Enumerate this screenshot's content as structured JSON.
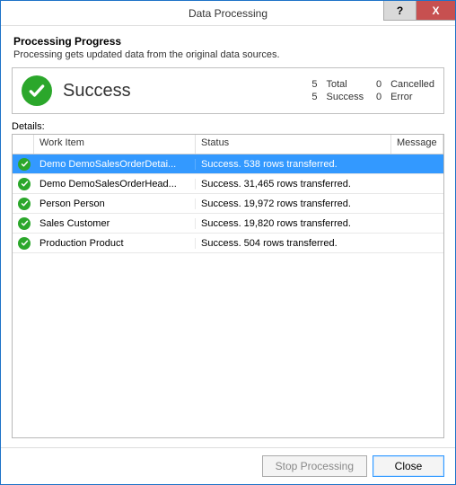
{
  "window": {
    "title": "Data Processing",
    "help_label": "?",
    "close_label": "X"
  },
  "header": {
    "title": "Processing Progress",
    "description": "Processing gets updated data from the original data sources."
  },
  "status": {
    "overall": "Success",
    "stats": {
      "total_count": "5",
      "total_label": "Total",
      "cancelled_count": "0",
      "cancelled_label": "Cancelled",
      "success_count": "5",
      "success_label": "Success",
      "error_count": "0",
      "error_label": "Error"
    }
  },
  "details": {
    "label": "Details:",
    "columns": {
      "work_item": "Work Item",
      "status": "Status",
      "message": "Message"
    },
    "rows": [
      {
        "work_item": "Demo DemoSalesOrderDetai...",
        "status": "Success. 538 rows transferred.",
        "message": "",
        "selected": true
      },
      {
        "work_item": "Demo DemoSalesOrderHead...",
        "status": "Success. 31,465 rows transferred.",
        "message": "",
        "selected": false
      },
      {
        "work_item": "Person Person",
        "status": "Success. 19,972 rows transferred.",
        "message": "",
        "selected": false
      },
      {
        "work_item": "Sales Customer",
        "status": "Success. 19,820 rows transferred.",
        "message": "",
        "selected": false
      },
      {
        "work_item": "Production Product",
        "status": "Success. 504 rows transferred.",
        "message": "",
        "selected": false
      }
    ]
  },
  "buttons": {
    "stop": "Stop Processing",
    "close": "Close"
  }
}
